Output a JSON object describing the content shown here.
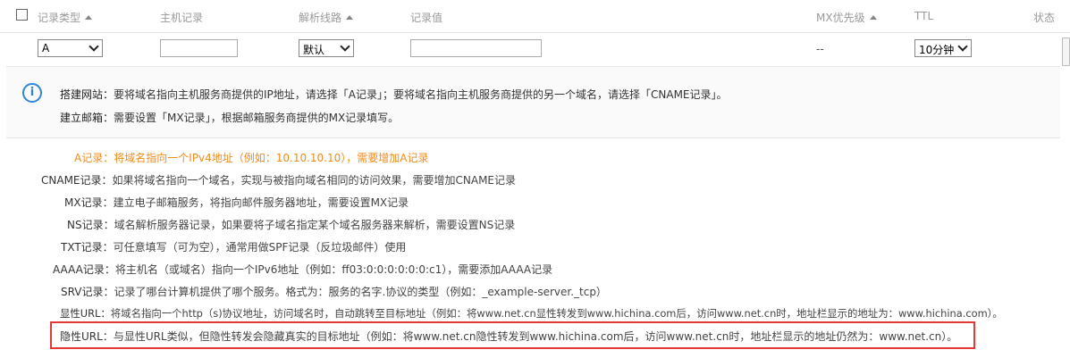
{
  "header": {
    "record_type": "记录类型",
    "host_record": "主机记录",
    "line": "解析线路",
    "record_value": "记录值",
    "mx_priority": "MX优先级",
    "ttl": "TTL",
    "status": "状态"
  },
  "edit_row": {
    "record_type_value": "A",
    "line_value": "默认",
    "mx_value": "--",
    "ttl_value": "10分钟"
  },
  "tips": {
    "website_label": "搭建网站：",
    "website_text": "要将域名指向主机服务商提供的IP地址，请选择「A记录」；要将域名指向主机服务商提供的另一个域名，请选择「CNAME记录」。",
    "mail_label": "建立邮箱：",
    "mail_text": "需要设置「MX记录」，根据邮箱服务商提供的MX记录填写。"
  },
  "descriptions": [
    {
      "label": "A记录：",
      "text": "将域名指向一个IPv4地址（例如：10.10.10.10），需要增加A记录"
    },
    {
      "label": "CNAME记录：",
      "text": "如果将域名指向一个域名，实现与被指向域名相同的访问效果，需要增加CNAME记录"
    },
    {
      "label": "MX记录：",
      "text": "建立电子邮箱服务，将指向邮件服务器地址，需要设置MX记录"
    },
    {
      "label": "NS记录：",
      "text": "域名解析服务器记录，如果要将子域名指定某个域名服务器来解析，需要设置NS记录"
    },
    {
      "label": "TXT记录：",
      "text": "可任意填写（可为空），通常用做SPF记录（反垃圾邮件）使用"
    },
    {
      "label": "AAAA记录：",
      "text": "将主机名（或域名）指向一个IPv6地址（例如：ff03:0:0:0:0:0:0:c1），需要添加AAAA记录"
    },
    {
      "label": "SRV记录：",
      "text": "记录了哪台计算机提供了哪个服务。格式为：服务的名字.协议的类型（例如：_example-server._tcp）"
    },
    {
      "label": "显性URL：",
      "text": "将域名指向一个http（s)协议地址，访问域名时，自动跳转至目标地址（例如：将www.net.cn显性转发到www.hichina.com后，访问www.net.cn时，地址栏显示的地址为：www.hichina.com）。"
    },
    {
      "label": "隐性URL：",
      "text": "与显性URL类似，但隐性转发会隐藏真实的目标地址（例如：将www.net.cn隐性转发到www.hichina.com后，访问www.net.cn时，地址栏显示的地址仍然为：www.net.cn）。"
    }
  ],
  "colors": {
    "highlight": "#f08c1c",
    "info_icon": "#2f86d6",
    "red_frame": "#e53935"
  }
}
